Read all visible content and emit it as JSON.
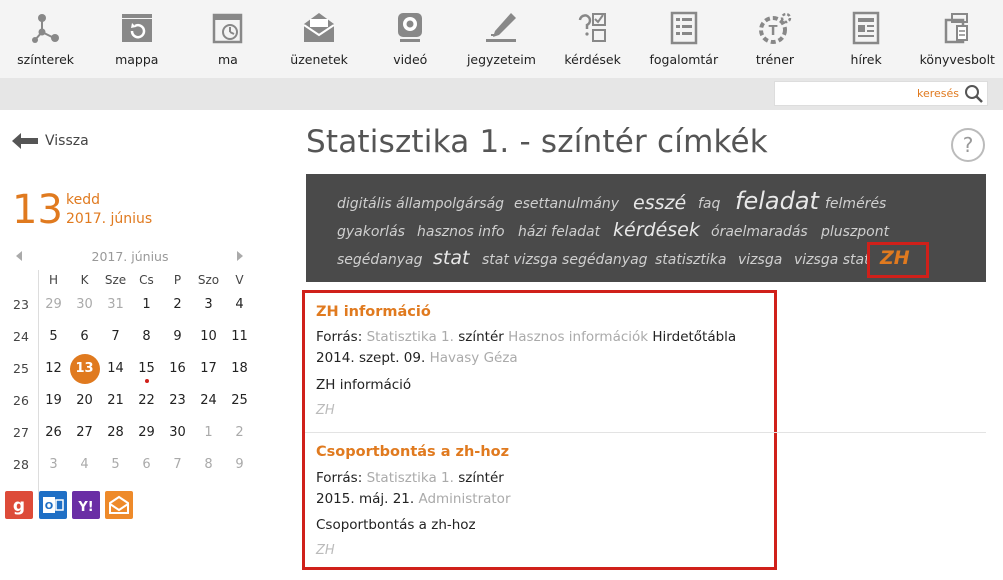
{
  "nav": [
    {
      "label": "színterek",
      "icon": "network-icon"
    },
    {
      "label": "mappa",
      "icon": "folder-icon"
    },
    {
      "label": "ma",
      "icon": "calendar-clock-icon"
    },
    {
      "label": "üzenetek",
      "icon": "envelope-icon"
    },
    {
      "label": "videó",
      "icon": "webcam-icon"
    },
    {
      "label": "jegyzeteim",
      "icon": "pencil-icon"
    },
    {
      "label": "kérdések",
      "icon": "question-checklist-icon"
    },
    {
      "label": "fogalomtár",
      "icon": "glossary-icon"
    },
    {
      "label": "tréner",
      "icon": "trainer-gear-icon"
    },
    {
      "label": "hírek",
      "icon": "newspaper-icon"
    },
    {
      "label": "könyvesbolt",
      "icon": "bookstore-icon"
    }
  ],
  "search": {
    "placeholder": "keresés"
  },
  "back_label": "Vissza",
  "date": {
    "day": "13",
    "weekday": "kedd",
    "date_str": "2017. június"
  },
  "calendar": {
    "title": "2017. június",
    "weekdays": [
      "H",
      "K",
      "Sze",
      "Cs",
      "P",
      "Szo",
      "V"
    ],
    "weeks": [
      {
        "num": "23",
        "days": [
          {
            "d": "29",
            "o": true
          },
          {
            "d": "30",
            "o": true
          },
          {
            "d": "31",
            "o": true
          },
          {
            "d": "1"
          },
          {
            "d": "2"
          },
          {
            "d": "3"
          },
          {
            "d": "4"
          }
        ]
      },
      {
        "num": "24",
        "days": [
          {
            "d": "5"
          },
          {
            "d": "6"
          },
          {
            "d": "7"
          },
          {
            "d": "8"
          },
          {
            "d": "9"
          },
          {
            "d": "10"
          },
          {
            "d": "11"
          }
        ]
      },
      {
        "num": "25",
        "days": [
          {
            "d": "12"
          },
          {
            "d": "13",
            "today": true
          },
          {
            "d": "14"
          },
          {
            "d": "15",
            "event": true
          },
          {
            "d": "16"
          },
          {
            "d": "17"
          },
          {
            "d": "18"
          }
        ]
      },
      {
        "num": "26",
        "days": [
          {
            "d": "19"
          },
          {
            "d": "20"
          },
          {
            "d": "21"
          },
          {
            "d": "22"
          },
          {
            "d": "23"
          },
          {
            "d": "24"
          },
          {
            "d": "25"
          }
        ]
      },
      {
        "num": "27",
        "days": [
          {
            "d": "26"
          },
          {
            "d": "27"
          },
          {
            "d": "28"
          },
          {
            "d": "29"
          },
          {
            "d": "30"
          },
          {
            "d": "1",
            "o": true
          },
          {
            "d": "2",
            "o": true
          }
        ]
      },
      {
        "num": "28",
        "days": [
          {
            "d": "3",
            "o": true
          },
          {
            "d": "4",
            "o": true
          },
          {
            "d": "5",
            "o": true
          },
          {
            "d": "6",
            "o": true
          },
          {
            "d": "7",
            "o": true
          },
          {
            "d": "8",
            "o": true
          },
          {
            "d": "9",
            "o": true
          }
        ]
      }
    ]
  },
  "social": [
    {
      "name": "google-icon",
      "color": "#dd4b39",
      "glyph": "g"
    },
    {
      "name": "outlook-icon",
      "color": "#1f6fc5",
      "glyph": "O"
    },
    {
      "name": "yahoo-icon",
      "color": "#6a2ea5",
      "glyph": "Y!"
    },
    {
      "name": "mail-icon",
      "color": "#ee8a2a",
      "glyph": ""
    }
  ],
  "page_title": "Statisztika 1. - színtér címkék",
  "help_label": "?",
  "tags": [
    {
      "text": "digitális állampolgárság",
      "size": "small"
    },
    {
      "text": "esettanulmány",
      "size": "small"
    },
    {
      "text": "esszé",
      "size": "large"
    },
    {
      "text": "faq",
      "size": "small"
    },
    {
      "text": "feladat",
      "size": "xlarge"
    },
    {
      "text": "felmérés",
      "size": "small"
    },
    {
      "text": "gyakorlás",
      "size": "small"
    },
    {
      "text": "hasznos info",
      "size": "small"
    },
    {
      "text": "házi feladat",
      "size": "small"
    },
    {
      "text": "kérdések",
      "size": "large"
    },
    {
      "text": "óraelmaradás",
      "size": "small"
    },
    {
      "text": "pluszpont",
      "size": "small"
    },
    {
      "text": "segédanyag",
      "size": "small"
    },
    {
      "text": "stat",
      "size": "large"
    },
    {
      "text": "stat vizsga segédanyag",
      "size": "small"
    },
    {
      "text": "statisztika",
      "size": "small"
    },
    {
      "text": "vizsga",
      "size": "small"
    },
    {
      "text": "vizsga stat",
      "size": "small"
    },
    {
      "text": "ZH",
      "size": "large",
      "selected": true
    }
  ],
  "accent_color": "#e07a1f",
  "highlight_color": "#d0201a",
  "results": [
    {
      "title": "ZH információ",
      "source_label": "Forrás:",
      "scene": "Statisztika 1.",
      "scene_word": "színtér",
      "category": "Hasznos információk",
      "board": "Hirdetőtábla",
      "date": "2014. szept. 09.",
      "author": "Havasy Géza",
      "body": "ZH információ",
      "tag": "ZH"
    },
    {
      "title": "Csoportbontás a zh-hoz",
      "source_label": "Forrás:",
      "scene": "Statisztika 1.",
      "scene_word": "színtér",
      "date": "2015. máj. 21.",
      "author": "Administrator",
      "body": "Csoportbontás a zh-hoz",
      "tag": "ZH"
    }
  ]
}
